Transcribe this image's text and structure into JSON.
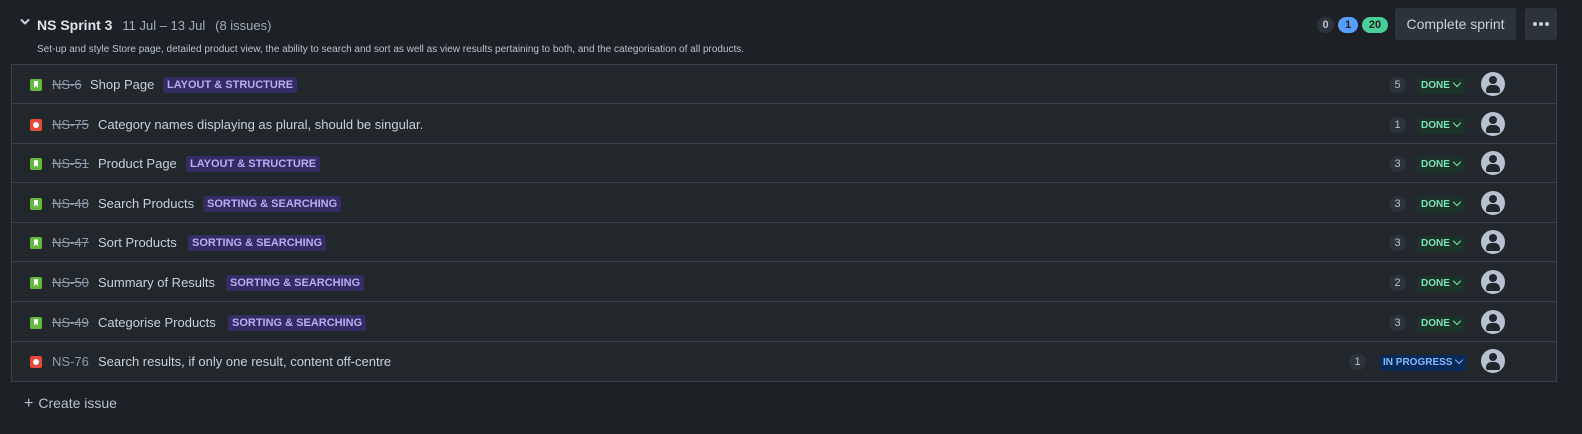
{
  "sprint": {
    "name": "NS Sprint 3",
    "dates": "11 Jul – 13 Jul",
    "issue_count": "(8 issues)",
    "goal": "Set-up and style Store page, detailed product view, the ability to search and sort as well as view results pertaining to both, and the categorisation of all products.",
    "stats": {
      "todo": "0",
      "in_progress": "1",
      "done": "20"
    },
    "complete_label": "Complete sprint"
  },
  "issues": [
    {
      "type": "story",
      "key": "NS-6",
      "summary": "Shop Page",
      "epic": "LAYOUT & STRUCTURE",
      "points": "5",
      "status": "DONE"
    },
    {
      "type": "bug",
      "key": "NS-75",
      "summary": "Category names displaying as plural, should be singular.",
      "epic": "",
      "points": "1",
      "status": "DONE"
    },
    {
      "type": "story",
      "key": "NS-51",
      "summary": "Product Page",
      "epic": "LAYOUT & STRUCTURE",
      "points": "3",
      "status": "DONE"
    },
    {
      "type": "story",
      "key": "NS-48",
      "summary": "Search Products",
      "epic": "SORTING & SEARCHING",
      "points": "3",
      "status": "DONE"
    },
    {
      "type": "story",
      "key": "NS-47",
      "summary": "Sort Products",
      "epic": "SORTING & SEARCHING",
      "points": "3",
      "status": "DONE"
    },
    {
      "type": "story",
      "key": "NS-50",
      "summary": "Summary of Results",
      "epic": "SORTING & SEARCHING",
      "points": "2",
      "status": "DONE"
    },
    {
      "type": "story",
      "key": "NS-49",
      "summary": "Categorise Products",
      "epic": "SORTING & SEARCHING",
      "points": "3",
      "status": "DONE"
    },
    {
      "type": "bug",
      "key": "NS-76",
      "summary": "Search results, if only one result, content off-centre",
      "epic": "",
      "points": "1",
      "status": "IN PROGRESS"
    }
  ],
  "create_label": "Create issue",
  "colors": {
    "story": "#63ba3c",
    "bug": "#e5493a",
    "done": "#7ee2b8",
    "in_progress": "#85b8ff",
    "epic": "#b8acf6"
  }
}
